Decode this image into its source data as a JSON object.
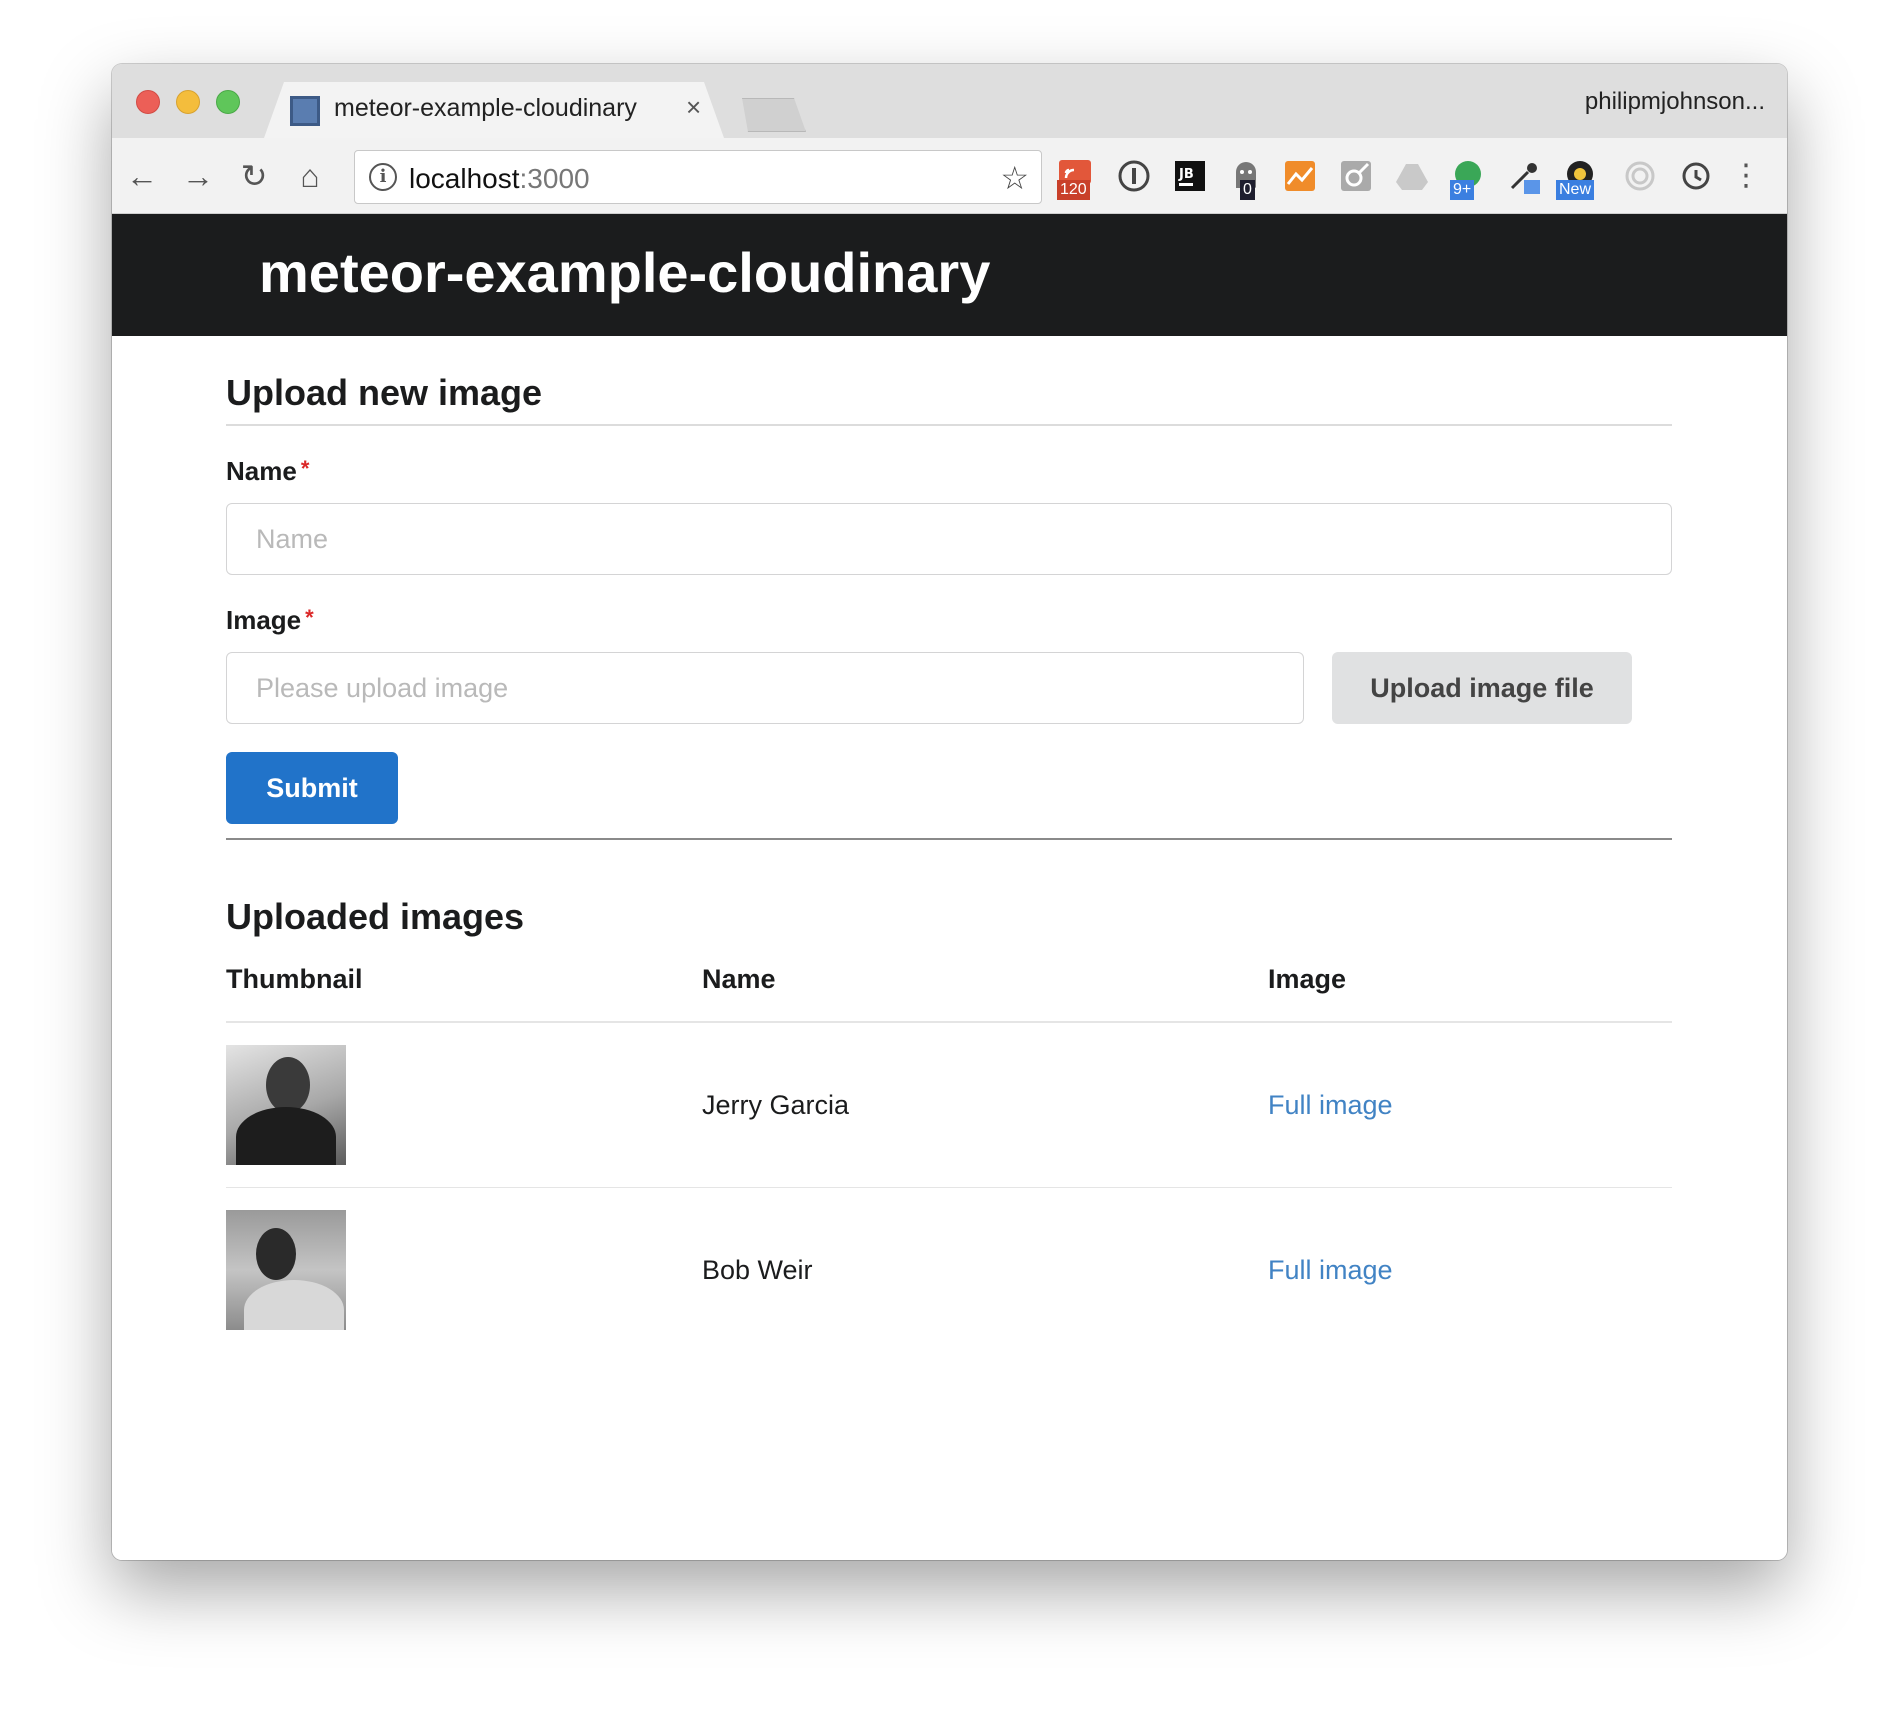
{
  "browser": {
    "tab_title": "meteor-example-cloudinary",
    "tab_close": "×",
    "profile_name": "philipmjohnson...",
    "url_host": "localhost",
    "url_port": ":3000",
    "nav": {
      "back": "←",
      "forward": "→",
      "reload": "↻",
      "home": "⌂"
    },
    "star": "☆",
    "menu": "⋮",
    "extensions": [
      {
        "name": "rss-extension-icon",
        "badge": "120"
      },
      {
        "name": "onepassword-icon"
      },
      {
        "name": "jetbrains-icon",
        "glyph": "JB"
      },
      {
        "name": "ghostery-icon",
        "badge": "0"
      },
      {
        "name": "analytics-icon"
      },
      {
        "name": "pencil-extension-icon"
      },
      {
        "name": "drive-icon"
      },
      {
        "name": "hangouts-icon",
        "badge": "9+"
      },
      {
        "name": "eyedropper-icon"
      },
      {
        "name": "new-extension-icon",
        "badge": "New"
      },
      {
        "name": "fingerprint-icon"
      },
      {
        "name": "sync-icon"
      }
    ]
  },
  "app": {
    "brand": "meteor-example-cloudinary",
    "upload_form": {
      "title": "Upload new image",
      "name_label": "Name",
      "name_placeholder": "Name",
      "image_label": "Image",
      "image_placeholder": "Please upload image",
      "required_mark": "*",
      "upload_button": "Upload image file",
      "submit_button": "Submit"
    },
    "uploaded": {
      "title": "Uploaded images",
      "columns": [
        "Thumbnail",
        "Name",
        "Image"
      ],
      "rows": [
        {
          "name": "Jerry Garcia",
          "link": "Full image"
        },
        {
          "name": "Bob Weir",
          "link": "Full image"
        }
      ]
    }
  }
}
